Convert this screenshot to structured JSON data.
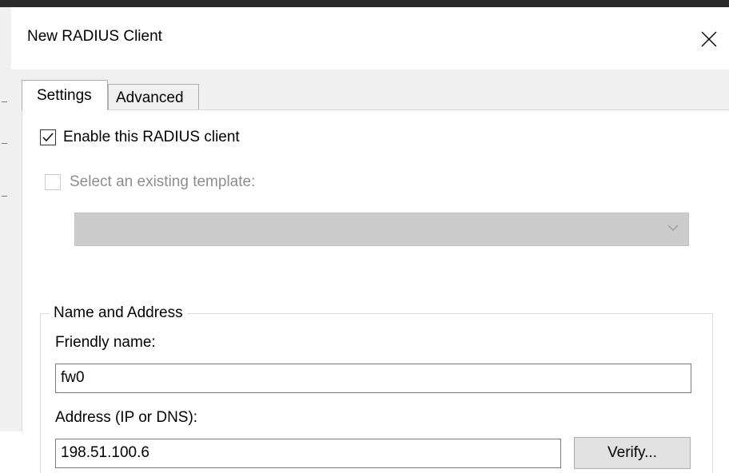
{
  "dialog": {
    "title": "New RADIUS Client"
  },
  "tabs": [
    {
      "label": "Settings",
      "selected": true
    },
    {
      "label": "Advanced",
      "selected": false
    }
  ],
  "settings": {
    "enable_client": {
      "label": "Enable this RADIUS client",
      "checked": true
    },
    "existing_template": {
      "label": "Select an existing template:",
      "checked": false,
      "enabled": false
    },
    "template_dropdown": {
      "value": "",
      "enabled": false
    },
    "name_address_group": {
      "legend": "Name and Address",
      "friendly_name": {
        "label": "Friendly name:",
        "value": "fw0"
      },
      "address": {
        "label": "Address (IP or DNS):",
        "value": "198.51.100.6"
      },
      "verify_button": "Verify..."
    }
  },
  "icons": {
    "close": "close-icon",
    "checkmark": "checkmark-icon",
    "dropdown": "chevron-down-icon"
  }
}
